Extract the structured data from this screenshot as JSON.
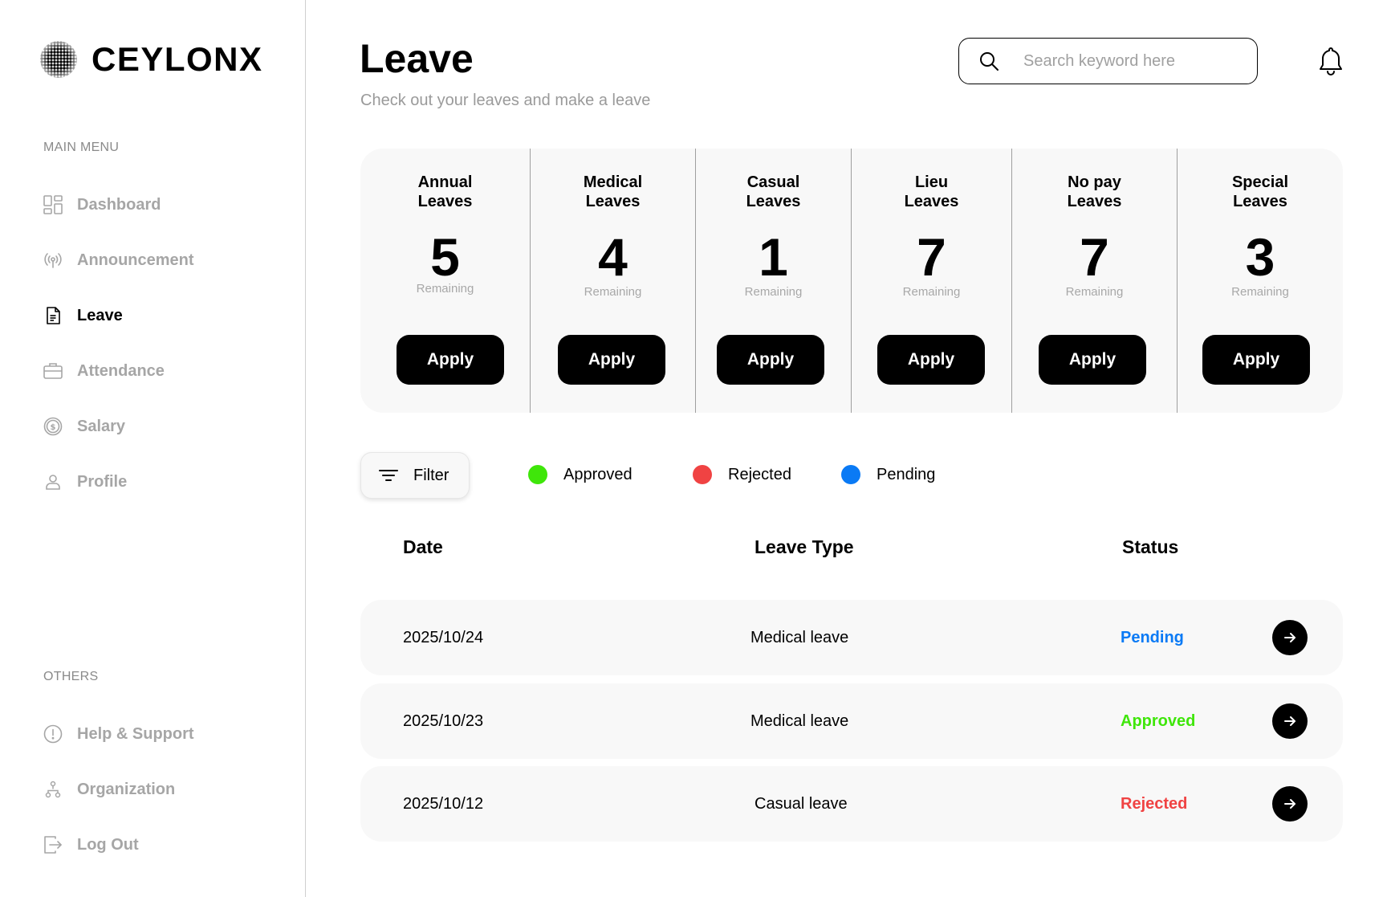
{
  "brand": {
    "name": "CEYLONX"
  },
  "sidebar": {
    "main_menu_label": "MAIN MENU",
    "others_label": "OTHERS",
    "items": [
      {
        "label": "Dashboard",
        "icon": "dashboard-icon"
      },
      {
        "label": "Announcement",
        "icon": "broadcast-icon"
      },
      {
        "label": "Leave",
        "icon": "document-icon",
        "active": true
      },
      {
        "label": "Attendance",
        "icon": "briefcase-icon"
      },
      {
        "label": "Salary",
        "icon": "dollar-icon"
      },
      {
        "label": "Profile",
        "icon": "user-icon"
      }
    ],
    "others": [
      {
        "label": "Help & Support",
        "icon": "info-icon"
      },
      {
        "label": "Organization",
        "icon": "org-chart-icon"
      },
      {
        "label": "Log Out",
        "icon": "logout-icon"
      }
    ]
  },
  "header": {
    "title": "Leave",
    "subtitle": "Check out your leaves and make a leave",
    "search_placeholder": "Search keyword here"
  },
  "leave_cards": [
    {
      "line1": "Annual",
      "line2": "Leaves",
      "count": "5",
      "remaining": "Remaining",
      "button": "Apply"
    },
    {
      "line1": "Medical",
      "line2": "Leaves",
      "count": "4",
      "remaining": "Remaining",
      "button": "Apply"
    },
    {
      "line1": "Casual",
      "line2": "Leaves",
      "count": "1",
      "remaining": "Remaining",
      "button": "Apply"
    },
    {
      "line1": "Lieu",
      "line2": "Leaves",
      "count": "7",
      "remaining": "Remaining",
      "button": "Apply"
    },
    {
      "line1": "No pay",
      "line2": "Leaves",
      "count": "7",
      "remaining": "Remaining",
      "button": "Apply"
    },
    {
      "line1": "Special",
      "line2": "Leaves",
      "count": "3",
      "remaining": "Remaining",
      "button": "Apply"
    }
  ],
  "filter": {
    "label": "Filter"
  },
  "legend": [
    {
      "label": "Approved",
      "color": "#3fe60a"
    },
    {
      "label": "Rejected",
      "color": "#f04343"
    },
    {
      "label": "Pending",
      "color": "#0a7af5"
    }
  ],
  "table": {
    "headers": {
      "date": "Date",
      "type": "Leave Type",
      "status": "Status"
    },
    "rows": [
      {
        "date": "2025/10/24",
        "type": "Medical leave",
        "status": "Pending",
        "status_color": "#0a7af5"
      },
      {
        "date": "2025/10/23",
        "type": "Medical leave",
        "status": "Approved",
        "status_color": "#3fe60a"
      },
      {
        "date": "2025/10/12",
        "type": "Casual leave",
        "status": "Rejected",
        "status_color": "#f04343"
      }
    ]
  }
}
